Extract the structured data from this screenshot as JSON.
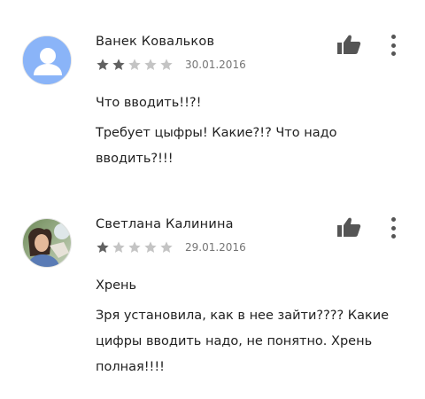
{
  "reviews": [
    {
      "author": "Ванек Ковальков",
      "date": "30.01.2016",
      "stars": 2,
      "max_stars": 5,
      "avatar": "default-person-avatar",
      "title": "Что вводить!!?!",
      "text": "Требует цыфры! Какие?!? Что надо вводить?!!!"
    },
    {
      "author": "Светлана Калинина",
      "date": "29.01.2016",
      "stars": 1,
      "max_stars": 5,
      "avatar": "photo-avatar",
      "title": "Хрень",
      "text": "Зря установила, как в нее зайти???? Какие цифры вводить надо, не понятно. Хрень полная!!!!"
    }
  ],
  "colors": {
    "star_filled": "#616161",
    "star_empty": "#c4c4c4",
    "icon": "#555555",
    "avatar_default_bg": "#8ab4f8"
  },
  "icons": [
    "thumbs-up-icon",
    "more-vert-icon",
    "star-icon"
  ]
}
